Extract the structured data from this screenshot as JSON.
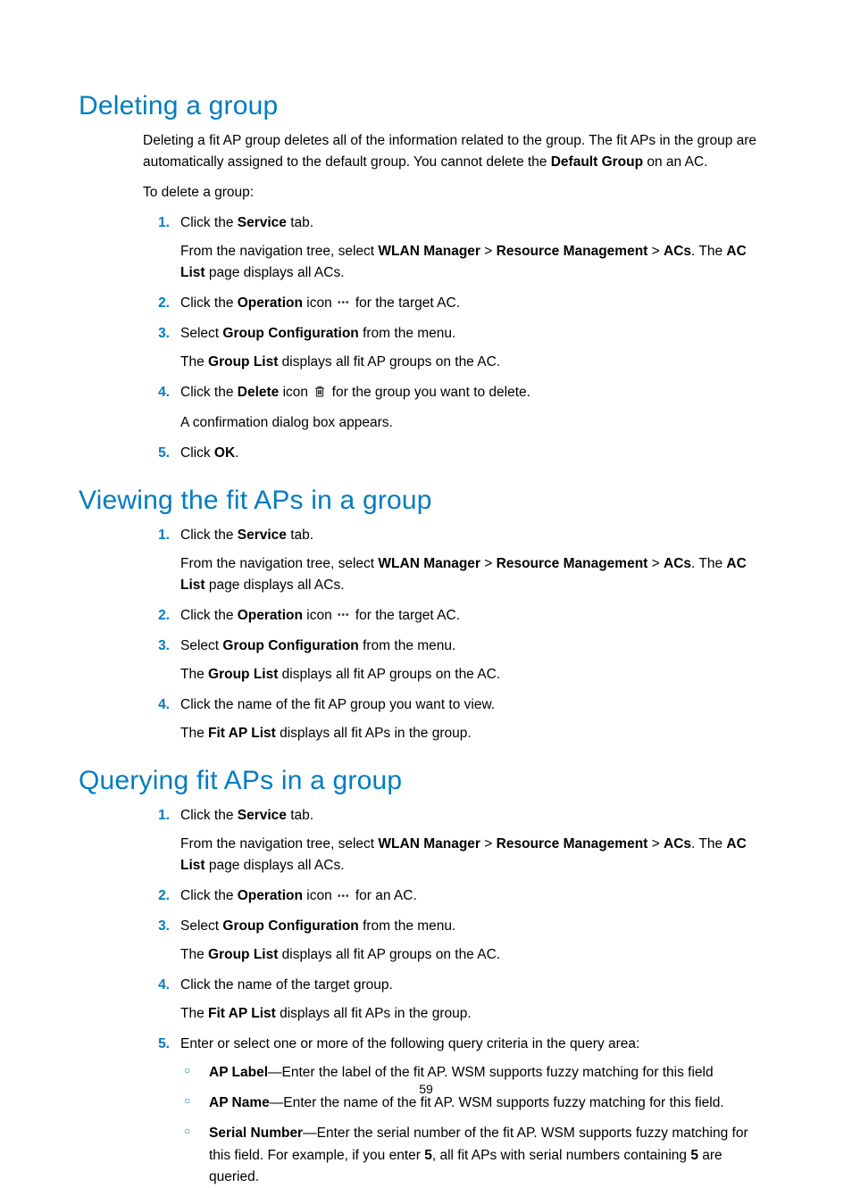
{
  "page_number": "59",
  "sections": [
    {
      "title": "Deleting a group",
      "intro": [
        {
          "runs": [
            {
              "t": "Deleting a fit AP group deletes all of the information related to the group. The fit APs in the group are automatically assigned to the default group. You cannot delete the "
            },
            {
              "t": "Default Group",
              "b": true
            },
            {
              "t": " on an AC."
            }
          ]
        },
        {
          "runs": [
            {
              "t": "To delete a group:"
            }
          ]
        }
      ],
      "steps": [
        {
          "num": "1.",
          "lines": [
            {
              "runs": [
                {
                  "t": "Click the "
                },
                {
                  "t": "Service",
                  "b": true
                },
                {
                  "t": " tab."
                }
              ]
            },
            {
              "runs": [
                {
                  "t": "From the navigation tree, select "
                },
                {
                  "t": "WLAN Manager",
                  "b": true
                },
                {
                  "t": " > "
                },
                {
                  "t": "Resource Management",
                  "b": true
                },
                {
                  "t": " > "
                },
                {
                  "t": "ACs",
                  "b": true
                },
                {
                  "t": ". The "
                },
                {
                  "t": "AC List",
                  "b": true
                },
                {
                  "t": " page displays all ACs."
                }
              ]
            }
          ]
        },
        {
          "num": "2.",
          "lines": [
            {
              "runs": [
                {
                  "t": "Click the "
                },
                {
                  "t": "Operation",
                  "b": true
                },
                {
                  "t": " icon "
                },
                {
                  "icon": "dots"
                },
                {
                  "t": " for the target AC."
                }
              ]
            }
          ]
        },
        {
          "num": "3.",
          "lines": [
            {
              "runs": [
                {
                  "t": "Select "
                },
                {
                  "t": "Group Configuration",
                  "b": true
                },
                {
                  "t": " from the menu."
                }
              ]
            },
            {
              "runs": [
                {
                  "t": "The "
                },
                {
                  "t": "Group List",
                  "b": true
                },
                {
                  "t": " displays all fit AP groups on the AC."
                }
              ]
            }
          ]
        },
        {
          "num": "4.",
          "lines": [
            {
              "runs": [
                {
                  "t": "Click the "
                },
                {
                  "t": "Delete",
                  "b": true
                },
                {
                  "t": " icon "
                },
                {
                  "icon": "trash"
                },
                {
                  "t": " for the group you want to delete."
                }
              ]
            },
            {
              "runs": [
                {
                  "t": "A confirmation dialog box appears."
                }
              ]
            }
          ]
        },
        {
          "num": "5.",
          "lines": [
            {
              "runs": [
                {
                  "t": "Click "
                },
                {
                  "t": "OK",
                  "b": true
                },
                {
                  "t": "."
                }
              ]
            }
          ]
        }
      ]
    },
    {
      "title": "Viewing the fit APs in a group",
      "steps": [
        {
          "num": "1.",
          "lines": [
            {
              "runs": [
                {
                  "t": "Click the "
                },
                {
                  "t": "Service",
                  "b": true
                },
                {
                  "t": " tab."
                }
              ]
            },
            {
              "runs": [
                {
                  "t": "From the navigation tree, select "
                },
                {
                  "t": "WLAN Manager",
                  "b": true
                },
                {
                  "t": " > "
                },
                {
                  "t": "Resource Management",
                  "b": true
                },
                {
                  "t": " > "
                },
                {
                  "t": "ACs",
                  "b": true
                },
                {
                  "t": ". The "
                },
                {
                  "t": "AC List",
                  "b": true
                },
                {
                  "t": " page displays all ACs."
                }
              ]
            }
          ]
        },
        {
          "num": "2.",
          "lines": [
            {
              "runs": [
                {
                  "t": "Click the "
                },
                {
                  "t": "Operation",
                  "b": true
                },
                {
                  "t": " icon "
                },
                {
                  "icon": "dots"
                },
                {
                  "t": " for the target AC."
                }
              ]
            }
          ]
        },
        {
          "num": "3.",
          "lines": [
            {
              "runs": [
                {
                  "t": "Select "
                },
                {
                  "t": "Group Configuration",
                  "b": true
                },
                {
                  "t": " from the menu."
                }
              ]
            },
            {
              "runs": [
                {
                  "t": "The "
                },
                {
                  "t": "Group List",
                  "b": true
                },
                {
                  "t": " displays all fit AP groups on the AC."
                }
              ]
            }
          ]
        },
        {
          "num": "4.",
          "lines": [
            {
              "runs": [
                {
                  "t": "Click the name of the fit AP group you want to view."
                }
              ]
            },
            {
              "runs": [
                {
                  "t": "The "
                },
                {
                  "t": "Fit AP List",
                  "b": true
                },
                {
                  "t": " displays all fit APs in the group."
                }
              ]
            }
          ]
        }
      ]
    },
    {
      "title": "Querying fit APs in a group",
      "steps": [
        {
          "num": "1.",
          "lines": [
            {
              "runs": [
                {
                  "t": "Click the "
                },
                {
                  "t": "Service",
                  "b": true
                },
                {
                  "t": " tab."
                }
              ]
            },
            {
              "runs": [
                {
                  "t": "From the navigation tree, select "
                },
                {
                  "t": "WLAN Manager",
                  "b": true
                },
                {
                  "t": " > "
                },
                {
                  "t": "Resource Management",
                  "b": true
                },
                {
                  "t": " > "
                },
                {
                  "t": "ACs",
                  "b": true
                },
                {
                  "t": ". The "
                },
                {
                  "t": "AC List",
                  "b": true
                },
                {
                  "t": " page displays all ACs."
                }
              ]
            }
          ]
        },
        {
          "num": "2.",
          "lines": [
            {
              "runs": [
                {
                  "t": "Click the "
                },
                {
                  "t": "Operation",
                  "b": true
                },
                {
                  "t": " icon "
                },
                {
                  "icon": "dots"
                },
                {
                  "t": " for an AC."
                }
              ]
            }
          ]
        },
        {
          "num": "3.",
          "lines": [
            {
              "runs": [
                {
                  "t": "Select "
                },
                {
                  "t": "Group Configuration",
                  "b": true
                },
                {
                  "t": " from the menu."
                }
              ]
            },
            {
              "runs": [
                {
                  "t": "The "
                },
                {
                  "t": "Group List",
                  "b": true
                },
                {
                  "t": " displays all fit AP groups on the AC."
                }
              ]
            }
          ]
        },
        {
          "num": "4.",
          "lines": [
            {
              "runs": [
                {
                  "t": "Click the name of the target group."
                }
              ]
            },
            {
              "runs": [
                {
                  "t": "The "
                },
                {
                  "t": "Fit AP List",
                  "b": true
                },
                {
                  "t": " displays all fit APs in the group."
                }
              ]
            }
          ]
        },
        {
          "num": "5.",
          "lines": [
            {
              "runs": [
                {
                  "t": "Enter or select one or more of the following query criteria in the query area:"
                }
              ]
            }
          ],
          "sub": [
            {
              "runs": [
                {
                  "t": "AP Label",
                  "b": true
                },
                {
                  "t": "—Enter the label of the fit AP. WSM supports fuzzy matching for this field"
                }
              ]
            },
            {
              "runs": [
                {
                  "t": "AP Name",
                  "b": true
                },
                {
                  "t": "—Enter the name of the fit AP. WSM supports fuzzy matching for this field."
                }
              ]
            },
            {
              "runs": [
                {
                  "t": "Serial Number",
                  "b": true
                },
                {
                  "t": "—Enter the serial number of the fit AP. WSM supports fuzzy matching for this field. For example, if you enter "
                },
                {
                  "t": "5",
                  "b": true
                },
                {
                  "t": ", all fit APs with serial numbers containing "
                },
                {
                  "t": "5",
                  "b": true
                },
                {
                  "t": " are queried."
                }
              ]
            }
          ]
        }
      ]
    }
  ]
}
